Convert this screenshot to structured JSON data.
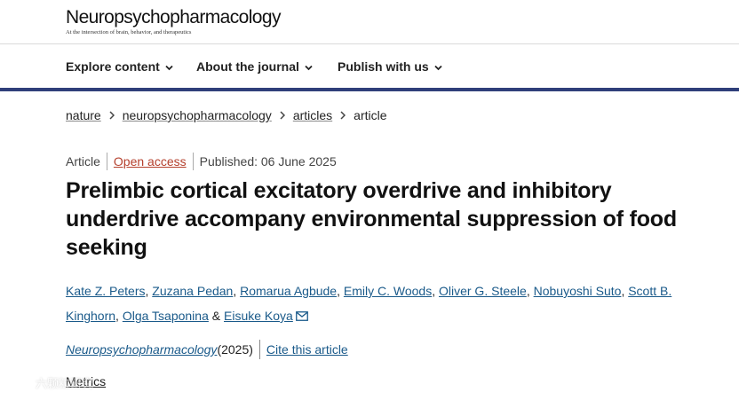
{
  "header": {
    "logo_title": "Neuropsychopharmacology",
    "logo_tagline": "At the intersection of brain, behavior, and therapeutics",
    "brand_rule_color": "#2f3f7a"
  },
  "nav": {
    "items": [
      {
        "label": "Explore content",
        "icon": "chevron-down-icon"
      },
      {
        "label": "About the journal",
        "icon": "chevron-down-icon"
      },
      {
        "label": "Publish with us",
        "icon": "chevron-down-icon"
      }
    ]
  },
  "breadcrumb": {
    "items": [
      "nature",
      "neuropsychopharmacology",
      "articles"
    ],
    "current": "article",
    "separator_icon": "chevron-right-icon"
  },
  "meta": {
    "type": "Article",
    "access": "Open access",
    "published": "Published: 06 June 2025",
    "access_color": "#b5402d"
  },
  "article": {
    "title": "Prelimbic cortical excitatory overdrive and inhibitory underdrive accompany environmental suppression of food seeking",
    "authors": [
      "Kate Z. Peters",
      "Zuzana Pedan",
      "Romarua Agbude",
      "Emily C. Woods",
      "Oliver G. Steele",
      "Nobuyoshi Suto",
      "Scott B. Kinghorn",
      "Olga Tsaponina",
      "Eisuke Koya"
    ],
    "author_sep": ", ",
    "author_final_sep": " & ",
    "corresponding_icon": "mail-icon",
    "link_color": "#1a5a8a"
  },
  "citation": {
    "journal": "Neuropsychopharmacology",
    "year": " (2025)",
    "cite_label": "Cite this article"
  },
  "metrics": {
    "label": "Metrics"
  },
  "watermark": {
    "text": "六颗粒研究"
  }
}
